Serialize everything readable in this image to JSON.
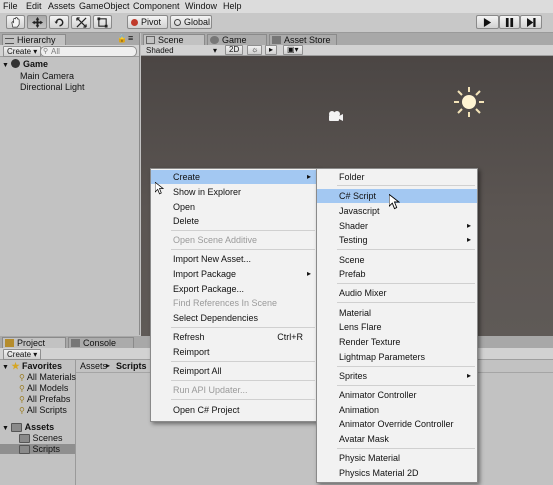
{
  "menubar": [
    "File",
    "Edit",
    "Assets",
    "GameObject",
    "Component",
    "Window",
    "Help"
  ],
  "toolbar": {
    "pivot_label": "Pivot",
    "global_label": "Global"
  },
  "hierarchy": {
    "tab_label": "Hierarchy",
    "create_label": "Create",
    "search_placeholder": "All",
    "scene_name": "Game",
    "items": [
      "Main Camera",
      "Directional Light"
    ]
  },
  "scene_view": {
    "tabs": [
      "Scene",
      "Game",
      "Asset Store"
    ],
    "shading_mode": "Shaded",
    "mode_2d": "2D"
  },
  "project": {
    "tabs": [
      "Project",
      "Console"
    ],
    "create_label": "Create",
    "favorites_label": "Favorites",
    "favorites": [
      "All Materials",
      "All Models",
      "All Prefabs",
      "All Scripts"
    ],
    "assets_label": "Assets",
    "asset_folders": [
      "Scenes",
      "Scripts"
    ],
    "breadcrumb": [
      "Assets",
      "Scripts"
    ]
  },
  "context_menu": {
    "items": [
      {
        "label": "Create",
        "submenu": true,
        "highlight": true
      },
      {
        "label": "Show in Explorer"
      },
      {
        "label": "Open"
      },
      {
        "label": "Delete"
      },
      {
        "label": "Open Scene Additive",
        "disabled": true
      },
      {
        "label": "Import New Asset..."
      },
      {
        "label": "Import Package",
        "submenu": true
      },
      {
        "label": "Export Package..."
      },
      {
        "label": "Find References In Scene",
        "disabled": true
      },
      {
        "label": "Select Dependencies"
      },
      {
        "label": "Refresh",
        "shortcut": "Ctrl+R"
      },
      {
        "label": "Reimport"
      },
      {
        "label": "Reimport All"
      },
      {
        "label": "Run API Updater...",
        "disabled": true
      },
      {
        "label": "Open C# Project"
      }
    ]
  },
  "create_submenu": {
    "items": [
      {
        "label": "Folder"
      },
      {
        "label": "C# Script",
        "highlight": true
      },
      {
        "label": "Javascript"
      },
      {
        "label": "Shader",
        "submenu": true
      },
      {
        "label": "Testing",
        "submenu": true
      },
      {
        "label": "Scene"
      },
      {
        "label": "Prefab"
      },
      {
        "label": "Audio Mixer"
      },
      {
        "label": "Material"
      },
      {
        "label": "Lens Flare"
      },
      {
        "label": "Render Texture"
      },
      {
        "label": "Lightmap Parameters"
      },
      {
        "label": "Sprites",
        "submenu": true
      },
      {
        "label": "Animator Controller"
      },
      {
        "label": "Animation"
      },
      {
        "label": "Animator Override Controller"
      },
      {
        "label": "Avatar Mask"
      },
      {
        "label": "Physic Material"
      },
      {
        "label": "Physics Material 2D"
      }
    ]
  },
  "colors": {
    "highlight": "#a3c8f2",
    "scene_bg": "#58524f",
    "menu_bg": "#f2f2f2"
  }
}
